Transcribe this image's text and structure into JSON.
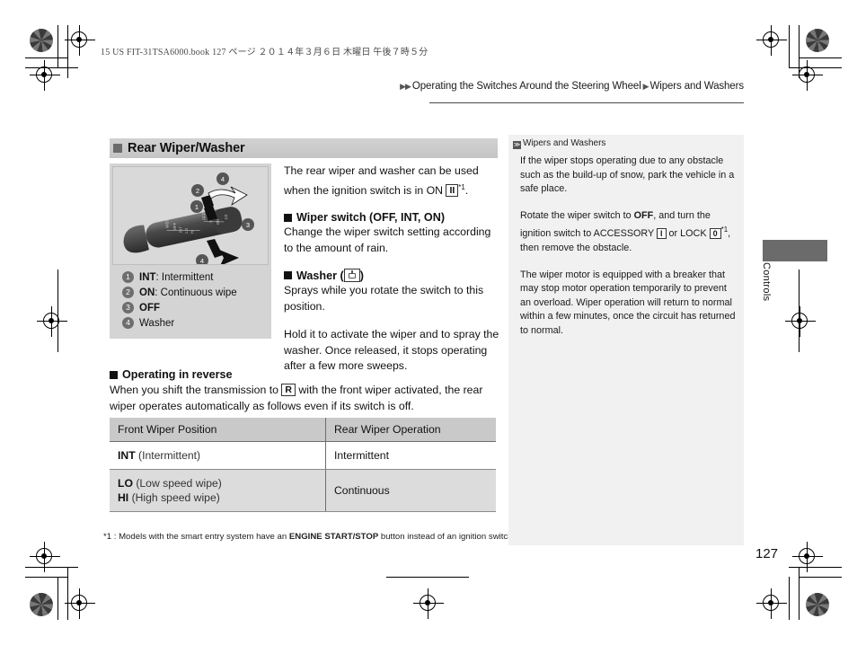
{
  "print": {
    "booknote": "15 US FIT-31TSA6000.book   127 ページ   ２０１４年３月６日   木曜日   午後７時５分"
  },
  "running_head": {
    "arrow1": "▶▶",
    "part1": "Operating the Switches Around the Steering Wheel",
    "arrow2": "▶",
    "part2": "Wipers and Washers"
  },
  "section": {
    "title": "Rear Wiper/Washer"
  },
  "illustration": {
    "callouts": [
      "1",
      "2",
      "3",
      "4",
      "4"
    ],
    "legend": [
      {
        "num": "1",
        "bold": "INT",
        "rest": ": Intermittent"
      },
      {
        "num": "2",
        "bold": "ON",
        "rest": ": Continuous wipe"
      },
      {
        "num": "3",
        "bold": "OFF",
        "rest": ""
      },
      {
        "num": "4",
        "bold": "",
        "rest": "Washer"
      }
    ]
  },
  "body": {
    "intro_a": "The rear wiper and washer can be used when the ignition switch is in ON",
    "intro_key": "II",
    "intro_sup": "*1",
    "intro_b": ".",
    "wiper_switch_heading": "Wiper switch (OFF, INT, ON)",
    "wiper_switch_text": "Change the wiper switch setting according to the amount of rain.",
    "washer_heading_pre": "Washer (",
    "washer_heading_post": ")",
    "washer_text": "Sprays while you rotate the switch to this position.",
    "hold_text": "Hold it to activate the wiper and to spray the washer. Once released, it stops operating after a few more sweeps."
  },
  "reverse": {
    "heading": "Operating in reverse",
    "text_a": "When you shift the transmission to",
    "key": "R",
    "text_b": "with the front wiper activated, the rear wiper operates automatically as follows even if its switch is off."
  },
  "table": {
    "headers": [
      "Front Wiper Position",
      "Rear Wiper Operation"
    ],
    "rows": [
      {
        "front_bold": "INT",
        "front_rest": " (Intermittent)",
        "front_bold2": "",
        "front_rest2": "",
        "rear": "Intermittent"
      },
      {
        "front_bold": "LO",
        "front_rest": " (Low speed wipe)",
        "front_bold2": "HI",
        "front_rest2": " (High speed wipe)",
        "rear": "Continuous"
      }
    ]
  },
  "footnote": {
    "pre": "*1 : Models with the smart entry system have an ",
    "bold": "ENGINE START/STOP",
    "post": " button instead of an ignition switch."
  },
  "sidebar": {
    "title": "Wipers and Washers",
    "title_mark": "≫",
    "p1": "If the wiper stops operating due to any obstacle such as the build-up of snow, park the vehicle in a safe place.",
    "p2_a": "Rotate the wiper switch to",
    "p2_off": "OFF",
    "p2_b": ", and turn the ignition switch to ACCESSORY",
    "p2_key1": "I",
    "p2_c": "or LOCK",
    "p2_key2": "0",
    "p2_sup": "*1",
    "p2_d": ", then remove the obstacle.",
    "p3": "The wiper motor is equipped with a breaker that may stop motor operation temporarily to prevent an overload. Wiper operation will return to normal within a few minutes, once the circuit has returned to normal."
  },
  "thumb_tab": {
    "label": "Controls"
  },
  "page": {
    "number": "127"
  },
  "colors": {
    "section_bar": "#c9c9c9",
    "sidebar_bg": "#f1f1f1",
    "tab_dark": "#6b6b6b",
    "table_header": "#c9c9c9",
    "table_alt_row": "#dcdcdc"
  }
}
